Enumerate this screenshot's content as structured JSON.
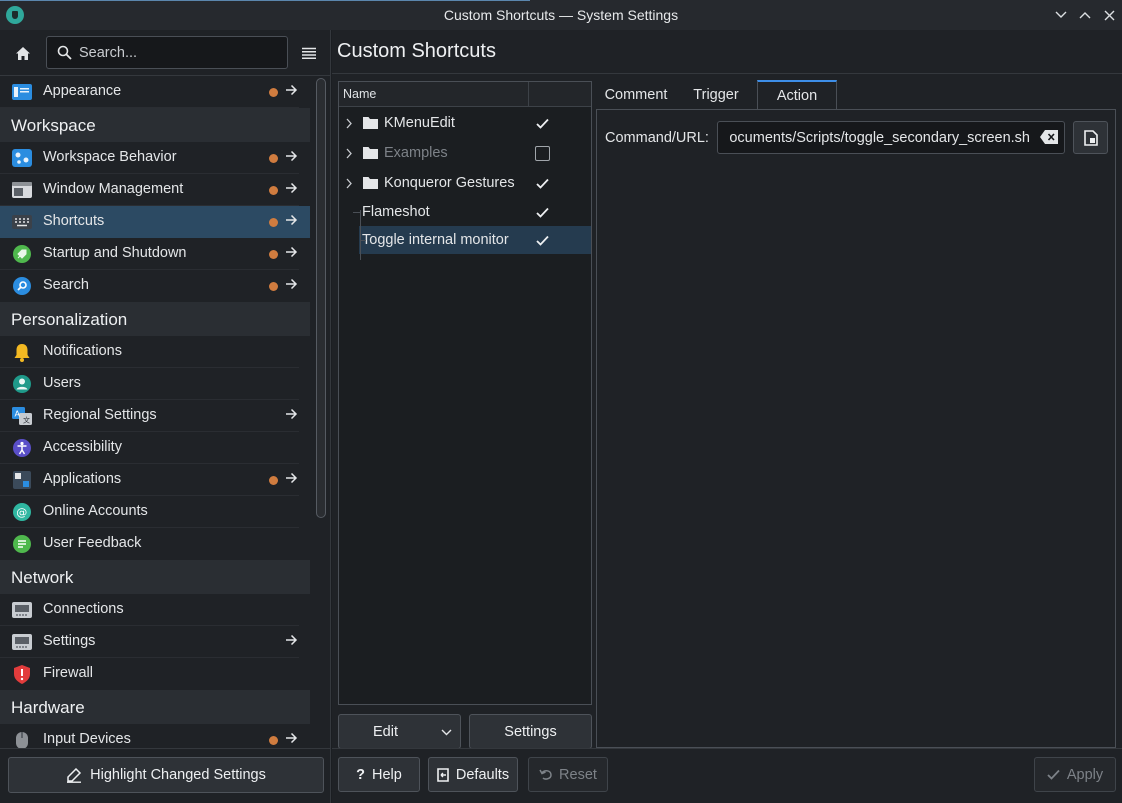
{
  "window": {
    "title": "Custom Shortcuts — System Settings"
  },
  "sidebar": {
    "search_placeholder": "Search...",
    "items": [
      {
        "type": "item",
        "label": "Appearance",
        "icon": "appearance-icon",
        "changed": true,
        "arrow": true
      },
      {
        "type": "category",
        "label": "Workspace"
      },
      {
        "type": "item",
        "label": "Workspace Behavior",
        "icon": "workspace-behavior-icon",
        "changed": true,
        "arrow": true
      },
      {
        "type": "item",
        "label": "Window Management",
        "icon": "window-management-icon",
        "changed": true,
        "arrow": true
      },
      {
        "type": "item",
        "label": "Shortcuts",
        "icon": "keyboard-icon",
        "changed": true,
        "arrow": true,
        "selected": true
      },
      {
        "type": "item",
        "label": "Startup and Shutdown",
        "icon": "rocket-icon",
        "changed": true,
        "arrow": true
      },
      {
        "type": "item",
        "label": "Search",
        "icon": "search-icon",
        "changed": true,
        "arrow": true
      },
      {
        "type": "category",
        "label": "Personalization"
      },
      {
        "type": "item",
        "label": "Notifications",
        "icon": "bell-icon"
      },
      {
        "type": "item",
        "label": "Users",
        "icon": "user-icon"
      },
      {
        "type": "item",
        "label": "Regional Settings",
        "icon": "language-icon",
        "arrow": true
      },
      {
        "type": "item",
        "label": "Accessibility",
        "icon": "accessibility-icon"
      },
      {
        "type": "item",
        "label": "Applications",
        "icon": "applications-icon",
        "changed": true,
        "arrow": true
      },
      {
        "type": "item",
        "label": "Online Accounts",
        "icon": "at-icon"
      },
      {
        "type": "item",
        "label": "User Feedback",
        "icon": "feedback-icon"
      },
      {
        "type": "category",
        "label": "Network"
      },
      {
        "type": "item",
        "label": "Connections",
        "icon": "network-card-icon"
      },
      {
        "type": "item",
        "label": "Settings",
        "icon": "network-settings-icon",
        "arrow": true
      },
      {
        "type": "item",
        "label": "Firewall",
        "icon": "shield-icon"
      },
      {
        "type": "category",
        "label": "Hardware"
      },
      {
        "type": "item",
        "label": "Input Devices",
        "icon": "mouse-icon",
        "changed": true,
        "arrow": true
      }
    ],
    "highlight_button": "Highlight Changed Settings"
  },
  "main": {
    "title": "Custom Shortcuts",
    "tree": {
      "column_header": "Name",
      "rows": [
        {
          "label": "KMenuEdit",
          "folder": true,
          "checked": true,
          "enabled": true
        },
        {
          "label": "Examples",
          "folder": true,
          "checked": false,
          "enabled": false
        },
        {
          "label": "Konqueror Gestures",
          "folder": true,
          "checked": true,
          "enabled": true
        },
        {
          "label": "Flameshot",
          "folder": false,
          "checked": true,
          "enabled": true
        },
        {
          "label": "Toggle internal monitor",
          "folder": false,
          "checked": true,
          "enabled": true,
          "selected": true
        }
      ]
    },
    "edit_button": "Edit",
    "settings_button": "Settings",
    "tabs": [
      {
        "label": "Comment",
        "active": false
      },
      {
        "label": "Trigger",
        "active": false
      },
      {
        "label": "Action",
        "active": true
      }
    ],
    "action": {
      "command_label": "Command/URL:",
      "command_value": "ocuments/Scripts/toggle_secondary_screen.sh"
    },
    "footer": {
      "help": "Help",
      "defaults": "Defaults",
      "reset": "Reset",
      "apply": "Apply"
    }
  }
}
